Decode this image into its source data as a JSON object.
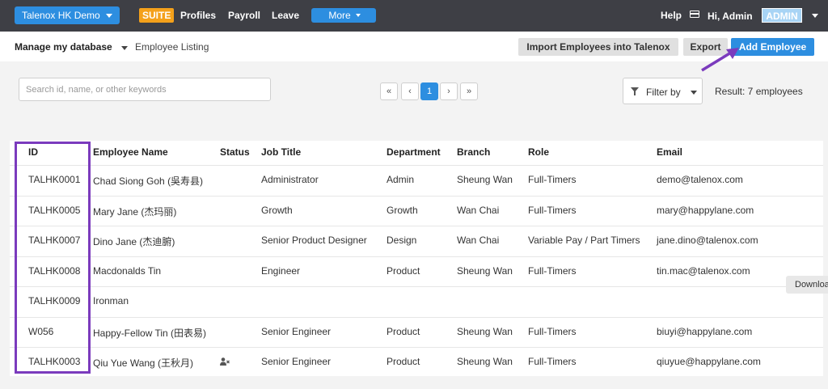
{
  "topnav": {
    "company": "Talenox HK Demo",
    "suite": "SUITE",
    "links": [
      "Profiles",
      "Payroll",
      "Leave"
    ],
    "more": "More",
    "help": "Help",
    "greeting": "Hi, Admin",
    "role_badge": "ADMIN"
  },
  "subheader": {
    "db_menu": "Manage my database",
    "breadcrumb": "Employee Listing",
    "import_button": "Import Employees into Talenox",
    "export_button": "Export",
    "add_button": "Add Employee"
  },
  "search": {
    "placeholder": "Search id, name, or other keywords"
  },
  "pagination": {
    "first": "«",
    "prev": "‹",
    "current": "1",
    "next": "›",
    "last": "»"
  },
  "filter": {
    "label": "Filter by"
  },
  "result": "Result: 7 employees",
  "table": {
    "headers": [
      "ID",
      "Employee Name",
      "Status",
      "Job Title",
      "Department",
      "Branch",
      "Role",
      "Email"
    ],
    "rows": [
      [
        "TALHK0001",
        "Chad Siong Goh (吳寿县)",
        "",
        "Administrator",
        "Admin",
        "Sheung Wan",
        "Full-Timers",
        "demo@talenox.com"
      ],
      [
        "TALHK0005",
        "Mary Jane (杰玛丽)",
        "",
        "Growth",
        "Growth",
        "Wan Chai",
        "Full-Timers",
        "mary@happylane.com"
      ],
      [
        "TALHK0007",
        "Dino Jane (杰迪腑)",
        "",
        "Senior Product Designer",
        "Design",
        "Wan Chai",
        "Variable Pay / Part Timers",
        "jane.dino@talenox.com"
      ],
      [
        "TALHK0008",
        "Macdonalds Tin",
        "",
        "Engineer",
        "Product",
        "Sheung Wan",
        "Full-Timers",
        "tin.mac@talenox.com"
      ],
      [
        "TALHK0009",
        "Ironman",
        "",
        "",
        "",
        "",
        "",
        ""
      ],
      [
        "W056",
        "Happy-Fellow Tin (田表易)",
        "",
        "Senior Engineer",
        "Product",
        "Sheung Wan",
        "Full-Timers",
        "biuyi@happylane.com"
      ],
      [
        "TALHK0003",
        "Qiu Yue Wang (王秋月)",
        "user-removed-icon",
        "Senior Engineer",
        "Product",
        "Sheung Wan",
        "Full-Timers",
        "qiuyue@happylane.com"
      ]
    ]
  },
  "download_tab": "Downloa",
  "colors": {
    "nav_bg": "#3e3f45",
    "primary": "#2d8ee0",
    "suite": "#f4a11b",
    "highlight": "#7b3bbd"
  }
}
